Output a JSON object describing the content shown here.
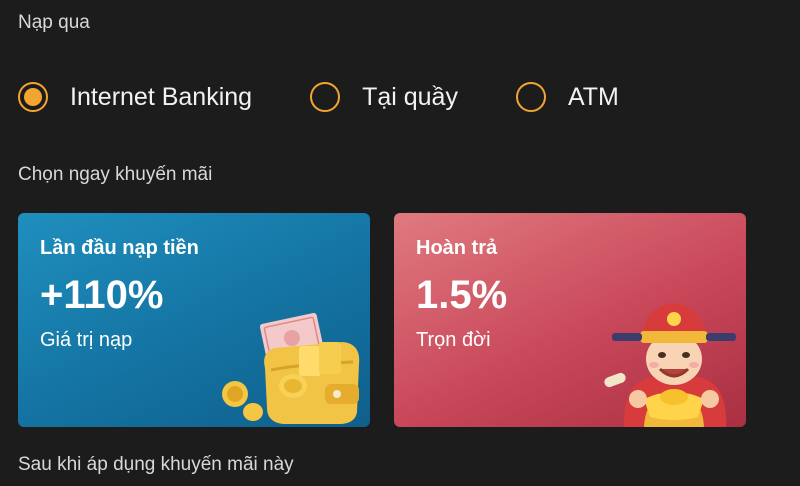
{
  "payment": {
    "section_label": "Nạp qua",
    "options": [
      {
        "label": "Internet Banking",
        "selected": true
      },
      {
        "label": "Tại quầy",
        "selected": false
      },
      {
        "label": "ATM",
        "selected": false
      }
    ]
  },
  "promotions": {
    "section_label": "Chọn ngay khuyến mãi",
    "cards": [
      {
        "title": "Lần đầu nạp tiền",
        "value": "+110%",
        "subtitle": "Giá trị nạp",
        "icon": "money-wallet-icon"
      },
      {
        "title": "Hoàn trả",
        "value": "1.5%",
        "subtitle": "Trọn đời",
        "icon": "fortune-god-icon"
      }
    ]
  },
  "after_promo": {
    "label": "Sau khi áp dụng khuyến mãi này"
  },
  "colors": {
    "accent": "#f3a531",
    "background": "#1c1c1c",
    "card_blue": "#1a7fb0",
    "card_red": "#c9485a"
  }
}
